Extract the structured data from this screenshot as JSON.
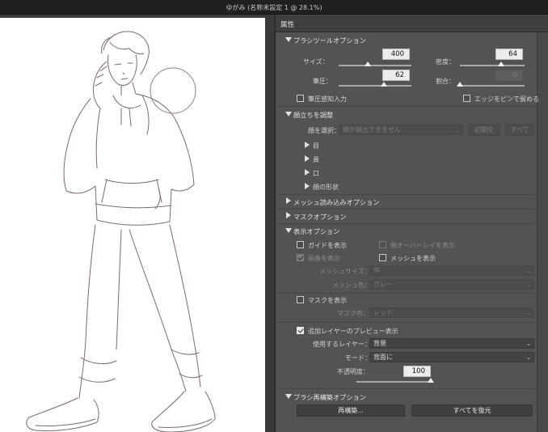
{
  "window": {
    "title": "ゆがみ (名称未設定 1 @ 28.1%)"
  },
  "panel": {
    "header": "属性"
  },
  "brush_options": {
    "title": "ブラシツールオプション",
    "size_label": "サイズ：",
    "size_value": "400",
    "size_level": 0.4,
    "density_label": "密度：",
    "density_value": "64",
    "density_level": 0.64,
    "pressure_label": "筆圧：",
    "pressure_value": "62",
    "pressure_level": 0.62,
    "rate_label": "割合：",
    "rate_value": "0",
    "rate_level": 0.0,
    "pen_pressure_label": "筆圧感知入力",
    "pen_pressure_checked": false,
    "pin_edges_label": "エッジをピンで留める",
    "pin_edges_checked": false
  },
  "face_adjust": {
    "title": "顔立ちを調整",
    "select_face_label": "顔を選択：",
    "select_face_value": "顔が検出できません",
    "reset_label": "初期化",
    "all_label": "すべて",
    "items": [
      "目",
      "鼻",
      "口",
      "顔の形状"
    ]
  },
  "mesh_load": {
    "title": "メッシュ読み込みオプション"
  },
  "mask_options": {
    "title": "マスクオプション"
  },
  "view_options": {
    "title": "表示オプション",
    "show_guides_label": "ガイドを表示",
    "show_guides_checked": false,
    "face_overlay_label": "顔オーバーレイを表示",
    "face_overlay_checked": false,
    "show_image_label": "画像を表示",
    "show_image_checked": true,
    "show_mesh_label": "メッシュを表示",
    "show_mesh_checked": false,
    "mesh_size_label": "メッシュサイズ：",
    "mesh_size_value": "中",
    "mesh_color_label": "メッシュ色：",
    "mesh_color_value": "グレー",
    "show_mask_label": "マスクを表示",
    "show_mask_checked": false,
    "mask_color_label": "マスク色：",
    "mask_color_value": "レッド",
    "backdrop_label": "追加レイヤーのプレビュー表示",
    "backdrop_checked": true,
    "use_layer_label": "使用するレイヤー：",
    "use_layer_value": "背景",
    "mode_label": "モード：",
    "mode_value": "背面に",
    "opacity_label": "不透明度：",
    "opacity_value": "100",
    "opacity_level": 1.0
  },
  "brush_reconstruct": {
    "title": "ブラシ再構築オプション",
    "reconstruct_label": "再構築...",
    "restore_all_label": "すべてを復元"
  },
  "colors": {
    "panel_bg": "#535353",
    "panel_header_bg": "#3f3f3f",
    "titlebar_bg": "#202020",
    "canvas_bg": "#ffffff",
    "input_bg": "#ececec",
    "sketch_stroke": "#7b6a6a"
  }
}
